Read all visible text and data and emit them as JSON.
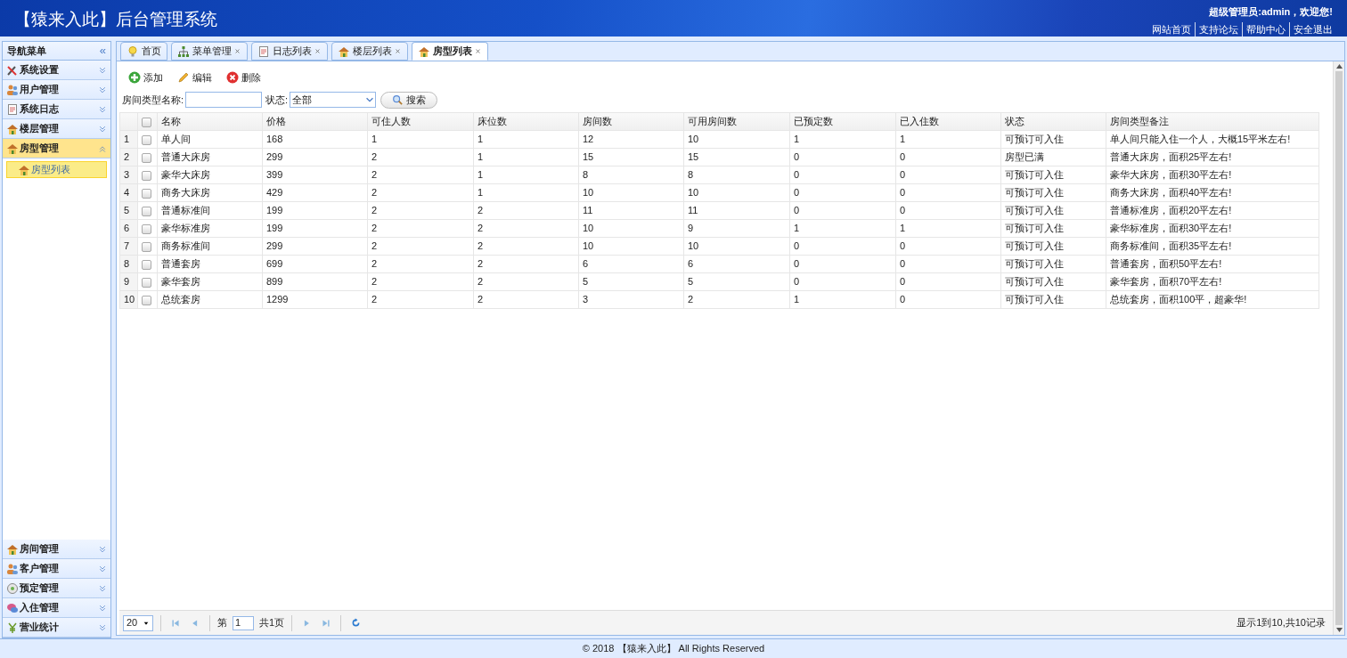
{
  "header": {
    "title": "【猿来入此】后台管理系统",
    "welcome": "超级管理员:admin，欢迎您!",
    "links": [
      "网站首页",
      "支持论坛",
      "帮助中心",
      "安全退出"
    ]
  },
  "sidebar": {
    "title": "导航菜单",
    "collapse": "«",
    "top_sections": [
      {
        "label": "系统设置",
        "expanded": false,
        "selected": false
      },
      {
        "label": "用户管理",
        "expanded": false,
        "selected": false
      },
      {
        "label": "系统日志",
        "expanded": false,
        "selected": false
      },
      {
        "label": "楼层管理",
        "expanded": false,
        "selected": false
      },
      {
        "label": "房型管理",
        "expanded": true,
        "selected": true,
        "children": [
          {
            "label": "房型列表",
            "selected": true
          }
        ]
      }
    ],
    "bottom_sections": [
      {
        "label": "房间管理",
        "expanded": false,
        "selected": false
      },
      {
        "label": "客户管理",
        "expanded": false,
        "selected": false
      },
      {
        "label": "预定管理",
        "expanded": false,
        "selected": false
      },
      {
        "label": "入住管理",
        "expanded": false,
        "selected": false
      },
      {
        "label": "营业统计",
        "expanded": false,
        "selected": false
      }
    ]
  },
  "tabs": [
    {
      "label": "首页",
      "closable": false,
      "selected": false
    },
    {
      "label": "菜单管理",
      "closable": true,
      "selected": false
    },
    {
      "label": "日志列表",
      "closable": true,
      "selected": false
    },
    {
      "label": "楼层列表",
      "closable": true,
      "selected": false
    },
    {
      "label": "房型列表",
      "closable": true,
      "selected": true
    }
  ],
  "toolbar": [
    {
      "label": "添加",
      "kind": "add"
    },
    {
      "label": "编辑",
      "kind": "edit"
    },
    {
      "label": "删除",
      "kind": "delete"
    }
  ],
  "search": {
    "name_label": "房间类型名称:",
    "status_label": "状态:",
    "status_value": "全部",
    "button": "搜索"
  },
  "table": {
    "all_checked": false,
    "columns": [
      "名称",
      "价格",
      "可住人数",
      "床位数",
      "房间数",
      "可用房间数",
      "已预定数",
      "已入住数",
      "状态",
      "房间类型备注"
    ],
    "rows": [
      {
        "index": "1",
        "checked": false,
        "cells": [
          "单人间",
          "168",
          "1",
          "1",
          "12",
          "10",
          "1",
          "1",
          "可预订可入住",
          "单人间只能入住一个人，大概15平米左右!"
        ]
      },
      {
        "index": "2",
        "checked": false,
        "cells": [
          "普通大床房",
          "299",
          "2",
          "1",
          "15",
          "15",
          "0",
          "0",
          "房型已满",
          "普通大床房，面积25平左右!"
        ]
      },
      {
        "index": "3",
        "checked": false,
        "cells": [
          "豪华大床房",
          "399",
          "2",
          "1",
          "8",
          "8",
          "0",
          "0",
          "可预订可入住",
          "豪华大床房，面积30平左右!"
        ]
      },
      {
        "index": "4",
        "checked": false,
        "cells": [
          "商务大床房",
          "429",
          "2",
          "1",
          "10",
          "10",
          "0",
          "0",
          "可预订可入住",
          "商务大床房，面积40平左右!"
        ]
      },
      {
        "index": "5",
        "checked": false,
        "cells": [
          "普通标准间",
          "199",
          "2",
          "2",
          "11",
          "11",
          "0",
          "0",
          "可预订可入住",
          "普通标准房，面积20平左右!"
        ]
      },
      {
        "index": "6",
        "checked": false,
        "cells": [
          "豪华标准房",
          "199",
          "2",
          "2",
          "10",
          "9",
          "1",
          "1",
          "可预订可入住",
          "豪华标准房，面积30平左右!"
        ]
      },
      {
        "index": "7",
        "checked": false,
        "cells": [
          "商务标准间",
          "299",
          "2",
          "2",
          "10",
          "10",
          "0",
          "0",
          "可预订可入住",
          "商务标准间，面积35平左右!"
        ]
      },
      {
        "index": "8",
        "checked": false,
        "cells": [
          "普通套房",
          "699",
          "2",
          "2",
          "6",
          "6",
          "0",
          "0",
          "可预订可入住",
          "普通套房，面积50平左右!"
        ]
      },
      {
        "index": "9",
        "checked": false,
        "cells": [
          "豪华套房",
          "899",
          "2",
          "2",
          "5",
          "5",
          "0",
          "0",
          "可预订可入住",
          "豪华套房，面积70平左右!"
        ]
      },
      {
        "index": "10",
        "checked": false,
        "cells": [
          "总统套房",
          "1299",
          "2",
          "2",
          "3",
          "2",
          "1",
          "0",
          "可预订可入住",
          "总统套房，面积100平，超豪华!"
        ]
      }
    ]
  },
  "pagination": {
    "page_size": "20",
    "page_prefix": "第",
    "page": "1",
    "page_total": "共1页",
    "summary": "显示1到10,共10记录"
  },
  "footer": "© 2018 【猿来入此】 All Rights Reserved"
}
